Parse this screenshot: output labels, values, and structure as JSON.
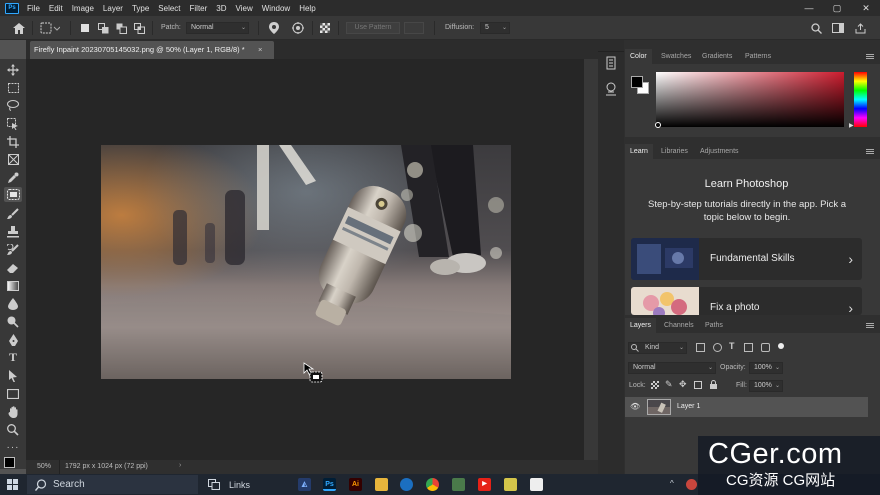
{
  "menubar": {
    "app_icon": "Ps",
    "items": [
      "File",
      "Edit",
      "Image",
      "Layer",
      "Type",
      "Select",
      "Filter",
      "3D",
      "View",
      "Window",
      "Help"
    ],
    "window_controls": [
      "minimize-icon",
      "maximize-icon",
      "close-icon"
    ]
  },
  "options_bar": {
    "patch_label": "Patch:",
    "patch_value": "Normal",
    "use_pattern_label": "Use Pattern",
    "diffusion_label": "Diffusion:",
    "diffusion_value": "5"
  },
  "document": {
    "tab_title": "Firefly Inpaint 20230705145032.png @ 50% (Layer 1, RGB/8) *",
    "tab_close": "×",
    "zoom": "50%",
    "dimensions": "1792 px x 1024 px (72 ppi)"
  },
  "color_panel": {
    "tabs": [
      "Color",
      "Swatches",
      "Gradients",
      "Patterns"
    ],
    "foreground": "#000000",
    "background": "#ffffff",
    "hue": "#cc1c2e"
  },
  "learn_panel": {
    "tabs": [
      "Learn",
      "Libraries",
      "Adjustments"
    ],
    "heading": "Learn Photoshop",
    "description": "Step-by-step tutorials directly in the app. Pick a topic below to begin.",
    "cards": [
      {
        "title": "Fundamental Skills",
        "arrow": "›"
      },
      {
        "title": "Fix a photo",
        "arrow": "›"
      }
    ]
  },
  "layers_panel": {
    "tabs": [
      "Layers",
      "Channels",
      "Paths"
    ],
    "kind_label": "Kind",
    "blend_mode": "Normal",
    "opacity_label": "Opacity:",
    "opacity_value": "100%",
    "lock_label": "Lock:",
    "fill_label": "Fill:",
    "fill_value": "100%",
    "layers": [
      {
        "name": "Layer 1",
        "visible": true
      }
    ]
  },
  "taskbar": {
    "search_placeholder": "Search",
    "links_label": "Links",
    "apps": [
      "Ps",
      "Ai"
    ]
  },
  "watermark": {
    "line1": "CGer.com",
    "line2": "CG资源 CG网站"
  }
}
